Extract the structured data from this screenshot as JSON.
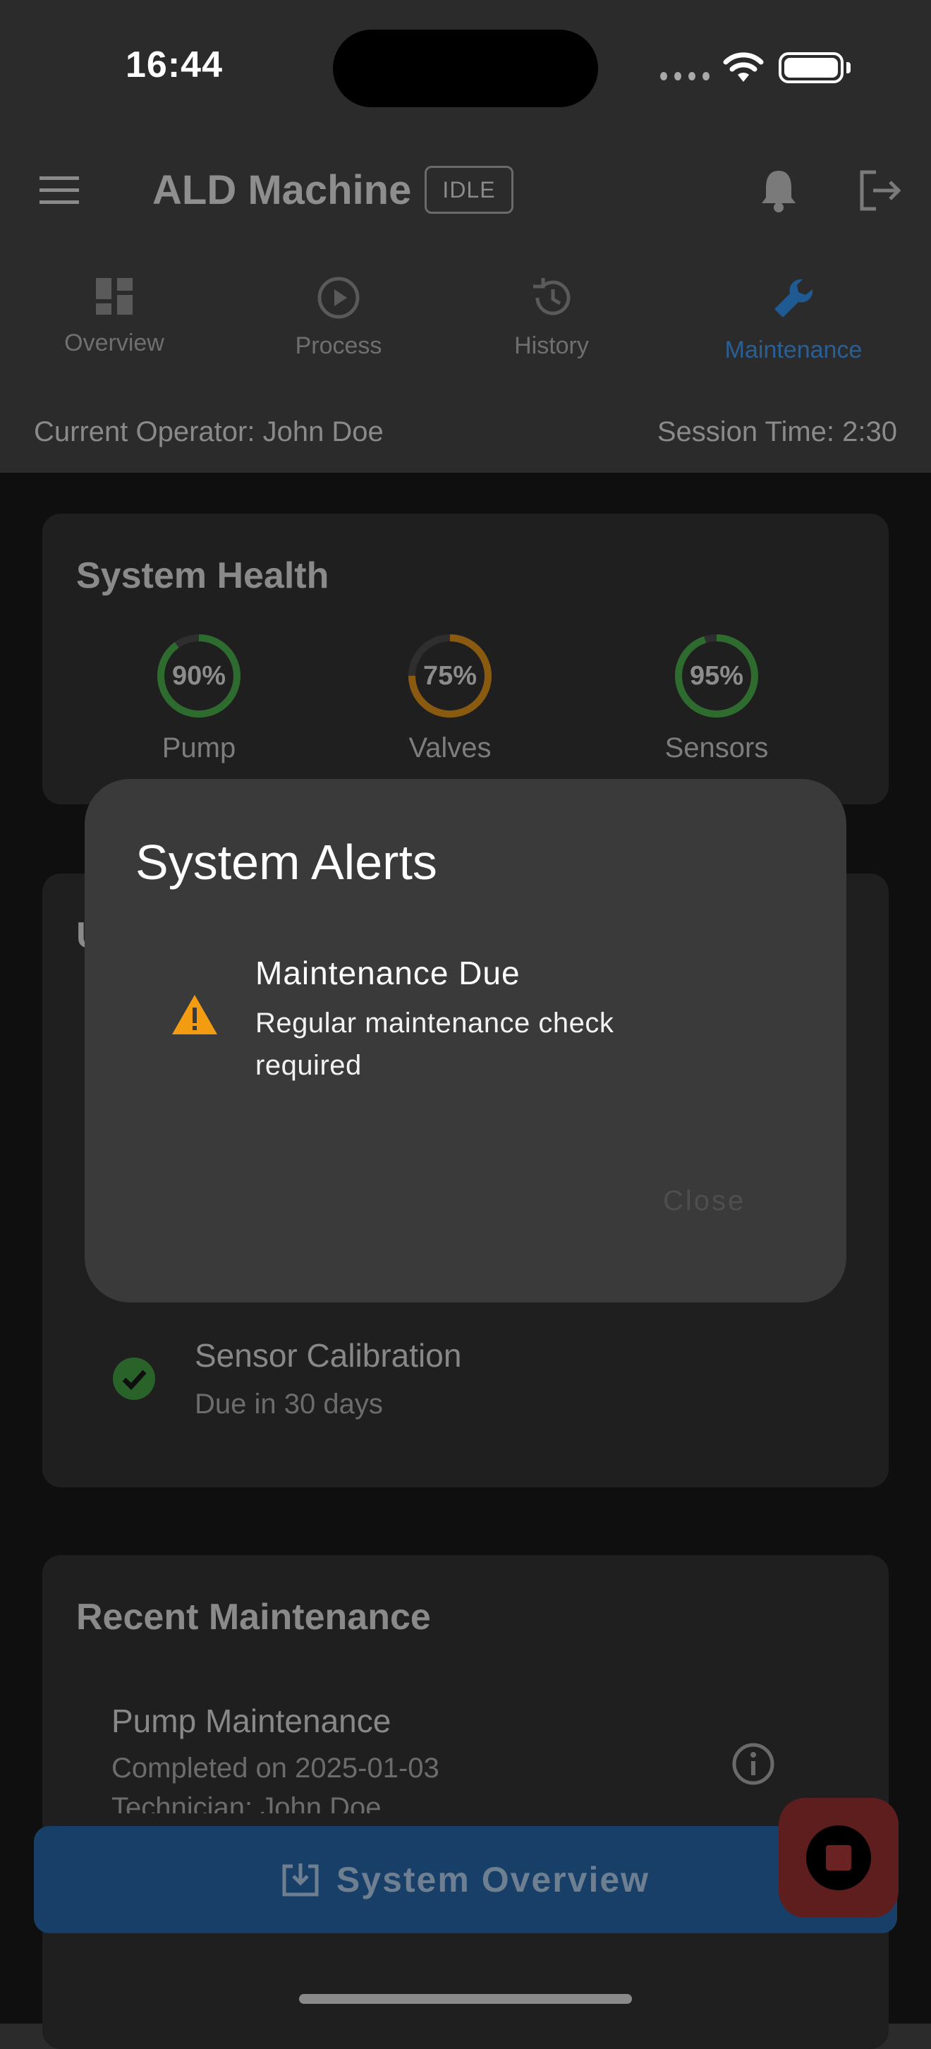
{
  "status_bar": {
    "time": "16:44"
  },
  "app_bar": {
    "title": "ALD Machine",
    "badge": "IDLE"
  },
  "tabs": [
    {
      "label": "Overview",
      "icon": "dashboard-icon",
      "active": false
    },
    {
      "label": "Process",
      "icon": "play-circle-icon",
      "active": false
    },
    {
      "label": "History",
      "icon": "history-icon",
      "active": false
    },
    {
      "label": "Maintenance",
      "icon": "wrench-icon",
      "active": true
    }
  ],
  "info_bar": {
    "operator": "Current Operator: John Doe",
    "session": "Session Time: 2:30"
  },
  "system_health": {
    "title": "System Health",
    "items": [
      {
        "label": "Pump",
        "value_text": "90%",
        "value": 0.9,
        "color": "#2e6b2e"
      },
      {
        "label": "Valves",
        "value_text": "75%",
        "value": 0.75,
        "color": "#8a5a10"
      },
      {
        "label": "Sensors",
        "value_text": "95%",
        "value": 0.95,
        "color": "#2e6b2e"
      }
    ]
  },
  "upcoming": {
    "title_partial": "U",
    "items": [
      {
        "title": "Sensor Calibration",
        "subtitle": "Due in 30 days",
        "icon": "check-circle-icon"
      }
    ]
  },
  "recent_maintenance": {
    "title": "Recent Maintenance",
    "items": [
      {
        "title": "Pump Maintenance",
        "line1": "Completed on 2025-01-03",
        "line2": "Technician: John Doe",
        "icon": "info-icon"
      }
    ]
  },
  "bottom_button": {
    "label": "System Overview",
    "icon": "download-box-icon"
  },
  "dialog": {
    "title": "System Alerts",
    "alert_title": "Maintenance Due",
    "alert_message": "Regular maintenance check required",
    "alert_icon": "warning-icon",
    "close_label": "Close"
  },
  "colors": {
    "accent": "#2a6fb5",
    "warning": "#f39c12",
    "success": "#3a8a3a",
    "danger": "#b33a3a"
  }
}
